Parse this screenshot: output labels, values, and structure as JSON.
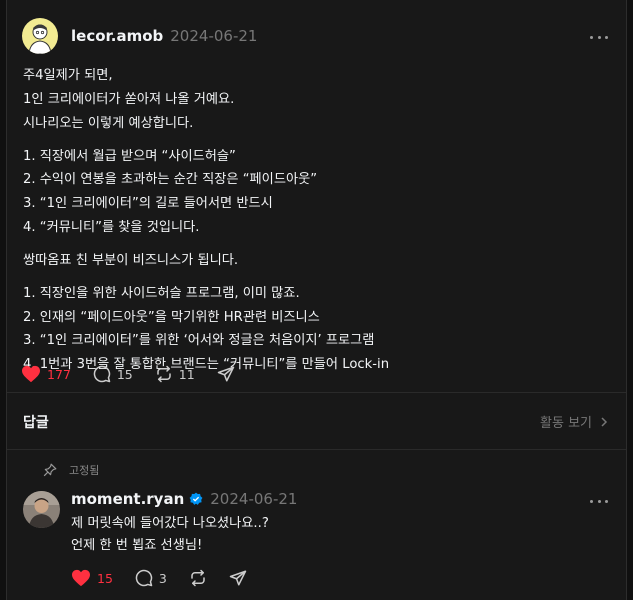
{
  "post": {
    "username": "lecor.amob",
    "date": "2024-06-21",
    "lines": [
      "주4일제가 되면,",
      "1인 크리에이터가 쏟아져 나올 거예요.",
      "시나리오는 이렇게 예상합니다.",
      "1. 직장에서 월급 받으며 “사이드허슬”",
      "2. 수익이 연봉을 초과하는 순간 직장은 “페이드아웃”",
      "3. “1인 크리에이터”의 길로 들어서면 반드시",
      "4. “커뮤니티”를 찾을 것입니다.",
      "쌍따옴표 친 부분이 비즈니스가 됩니다.",
      "1. 직장인을 위한 사이드허슬 프로그램, 이미 많죠.",
      "2. 인재의 “페이드아웃”을 막기위한 HR관련 비즈니스",
      "3. “1인 크리에이터”를 위한 ‘어서와 정글은 처음이지’ 프로그램",
      "4. 1번과 3번을 잘 통합한 브랜드는 “커뮤니티”를 만들어 Lock-in"
    ],
    "likes": "177",
    "comments": "15",
    "reposts": "11"
  },
  "replies_section": {
    "title": "답글",
    "activity_label": "활동 보기"
  },
  "pinned_label": "고정됨",
  "comment": {
    "username": "moment.ryan",
    "date": "2024-06-21",
    "lines": [
      "제 머릿속에 들어갔다 나오셨나요..?",
      "언제 한 번 뵙죠 선생님!"
    ],
    "likes": "15",
    "comments": "3"
  },
  "colors": {
    "background": "#181818",
    "like_red": "#ff3040",
    "verified_blue": "#0095f6",
    "muted": "#777777"
  },
  "icons": [
    "heart-icon",
    "comment-icon",
    "repost-icon",
    "share-icon",
    "more-icon",
    "pin-icon",
    "verified-badge-icon",
    "chevron-right-icon"
  ]
}
